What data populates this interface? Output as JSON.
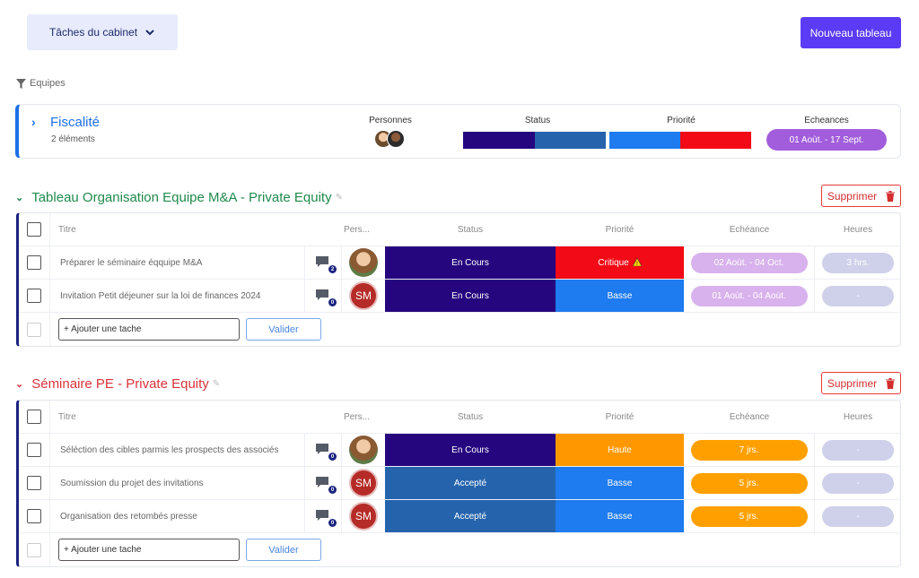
{
  "header": {
    "dropdown_label": "Tâches du cabinet",
    "new_board_label": "Nouveau tableau"
  },
  "filter": {
    "label": "Equipes"
  },
  "summary": {
    "title": "Fiscalité",
    "count": "2 éléments",
    "col_persons": "Personnes",
    "col_status": "Status",
    "col_priority": "Priorité",
    "col_deadlines": "Echeances",
    "deadline_range": "01 Aoùt. - 17 Sept.",
    "status_bar": [
      {
        "color": "#26067e",
        "fraction": 0.5
      },
      {
        "color": "#2564ad",
        "fraction": 0.5
      }
    ],
    "priority_bar": [
      {
        "color": "#1e7bf0",
        "fraction": 0.5
      },
      {
        "color": "#f20a16",
        "fraction": 0.5
      }
    ]
  },
  "columns": {
    "title": "Titre",
    "persons": "Pers...",
    "status": "Status",
    "priority": "Priorité",
    "due": "Echéance",
    "hours": "Heures"
  },
  "groups": [
    {
      "title": "Tableau Organisation Equipe M&A - Private Equity",
      "color": "#1f8a4c",
      "delete_label": "Supprimer",
      "add_placeholder": "+ Ajouter une tache",
      "validate_label": "Valider",
      "rows": [
        {
          "title": "Préparer le séminaire éqquipe M&A",
          "comments": "2",
          "person": "photo",
          "person_initials": "",
          "status": "En Cours",
          "status_color": "#26067e",
          "priority": "Critique",
          "priority_color": "#f20a16",
          "priority_warning": true,
          "due": "02 Aoùt. - 04 Oct.",
          "due_color": "#d8b2ec",
          "hours": "3 hrs."
        },
        {
          "title": "Invitation Petit déjeuner sur la loi de finances 2024",
          "comments": "0",
          "person": "initials",
          "person_initials": "SM",
          "status": "En Cours",
          "status_color": "#26067e",
          "priority": "Basse",
          "priority_color": "#1e7bf0",
          "priority_warning": false,
          "due": "01 Aoùt. - 04 Aoùt.",
          "due_color": "#d8b2ec",
          "hours": "-"
        }
      ]
    },
    {
      "title": "Séminaire PE - Private Equity",
      "color": "#d9323a",
      "delete_label": "Supprimer",
      "add_placeholder": "+ Ajouter une tache",
      "validate_label": "Valider",
      "rows": [
        {
          "title": "Séléction des cibles parmis les prospects des associés",
          "comments": "0",
          "person": "photo",
          "person_initials": "",
          "status": "En Cours",
          "status_color": "#26067e",
          "priority": "Haute",
          "priority_color": "#ff9800",
          "priority_warning": false,
          "due": "7 jrs.",
          "due_color": "#ffa000",
          "hours": "-"
        },
        {
          "title": "Soumission du projet des invitations",
          "comments": "0",
          "person": "initials",
          "person_initials": "SM",
          "status": "Accepté",
          "status_color": "#2564ad",
          "priority": "Basse",
          "priority_color": "#1e7bf0",
          "priority_warning": false,
          "due": "5 jrs.",
          "due_color": "#ffa000",
          "hours": "-"
        },
        {
          "title": "Organisation des retombés presse",
          "comments": "0",
          "person": "initials",
          "person_initials": "SM",
          "status": "Accepté",
          "status_color": "#2564ad",
          "priority": "Basse",
          "priority_color": "#1e7bf0",
          "priority_warning": false,
          "due": "5 jrs.",
          "due_color": "#ffa000",
          "hours": "-"
        }
      ]
    }
  ]
}
